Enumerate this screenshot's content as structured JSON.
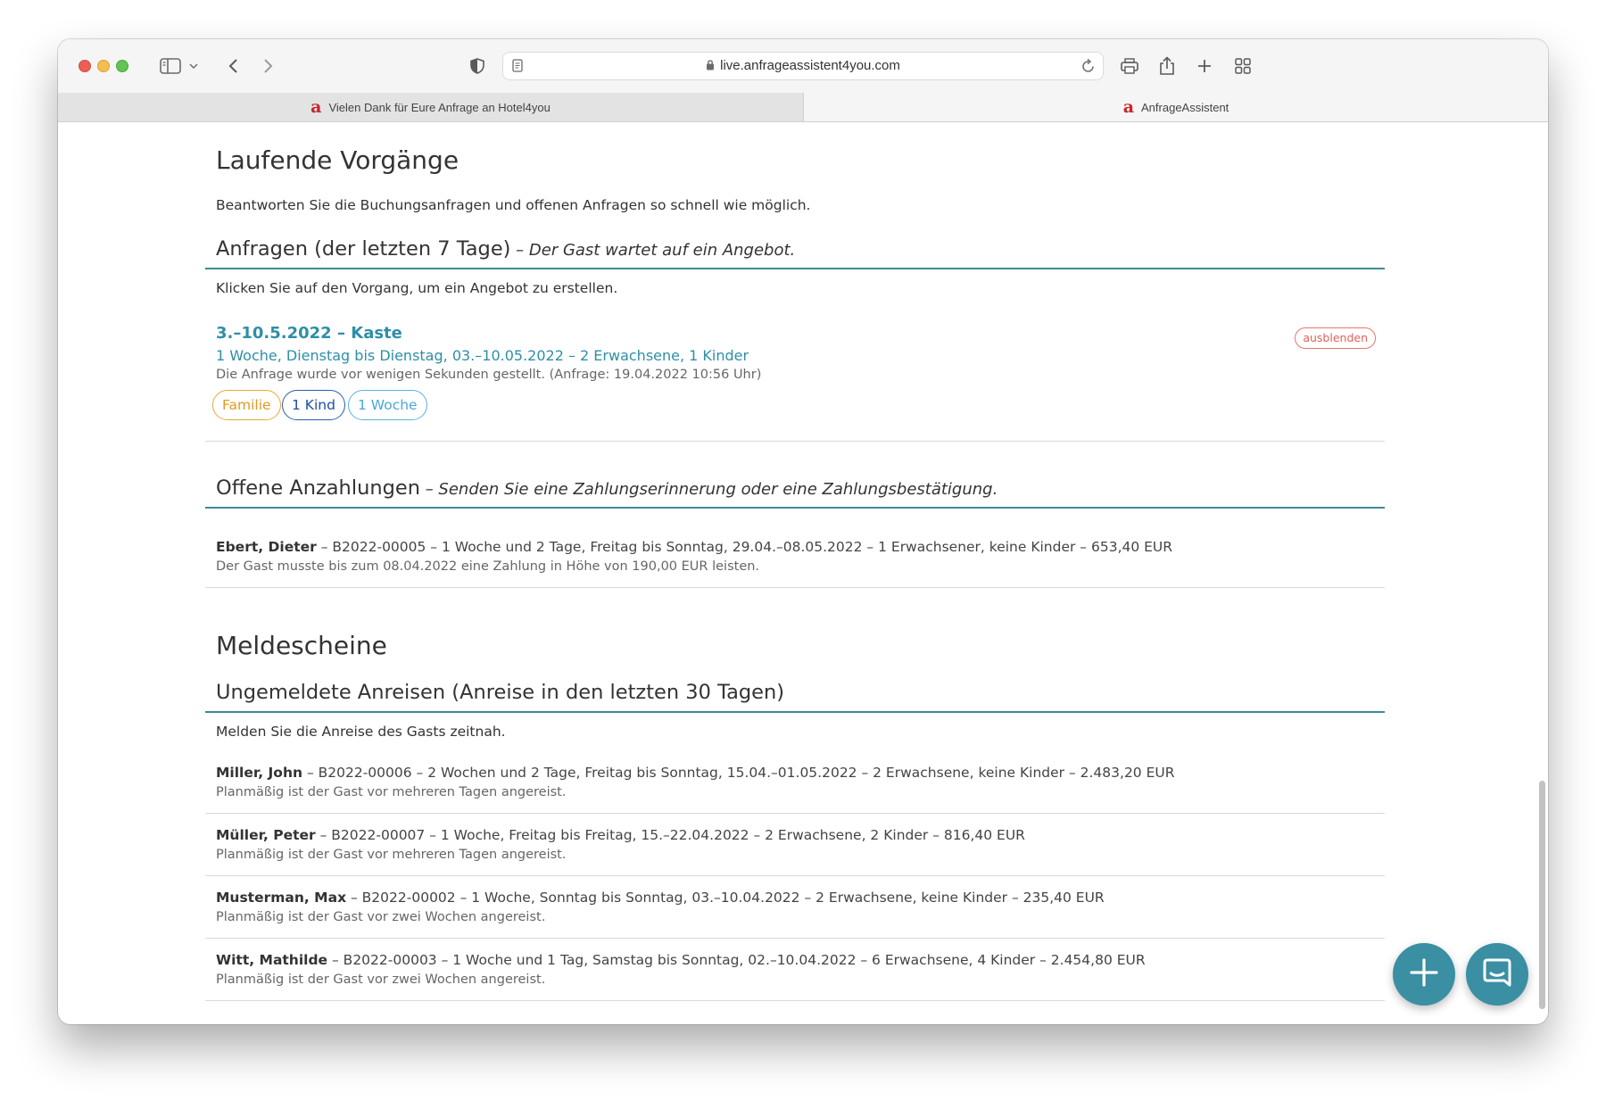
{
  "browser": {
    "url": "live.anfrageassistent4you.com",
    "tabs": [
      {
        "label": "Vielen Dank für Eure Anfrage an Hotel4you",
        "favicon": "a",
        "active": false
      },
      {
        "label": "AnfrageAssistent",
        "favicon": "a",
        "active": true
      }
    ]
  },
  "page": {
    "title": "Laufende Vorgänge",
    "intro": "Beantworten Sie die Buchungsanfragen und offenen Anfragen so schnell wie möglich."
  },
  "inquiries": {
    "heading": "Anfragen (der letzten 7 Tage)",
    "subheading": " – Der Gast wartet auf ein Angebot.",
    "hint": "Klicken Sie auf den Vorgang, um ein Angebot zu erstellen.",
    "items": [
      {
        "title": "3.–10.5.2022 – Kaste",
        "detail": "1 Woche, Dienstag bis Dienstag, 03.–10.05.2022 – 2 Erwachsene, 1 Kinder",
        "meta": "Die Anfrage wurde vor wenigen Sekunden gestellt. (Anfrage: 19.04.2022 10:56 Uhr)",
        "tags": [
          "Familie",
          "1 Kind",
          "1 Woche"
        ],
        "hide_label": "ausblenden"
      }
    ]
  },
  "deposits": {
    "heading": "Offene Anzahlungen",
    "subheading": " – Senden Sie eine Zahlungserinnerung oder eine Zahlungsbestätigung.",
    "items": [
      {
        "name": "Ebert, Dieter",
        "detail": " – B2022-00005 – 1 Woche und 2 Tage, Freitag bis Sonntag, 29.04.–08.05.2022 – 1 Erwachsener, keine Kinder – 653,40 EUR",
        "sub": "Der Gast musste bis zum 08.04.2022 eine Zahlung in Höhe von 190,00 EUR leisten."
      }
    ]
  },
  "registration": {
    "title": "Meldescheine",
    "heading": "Ungemeldete Anreisen (Anreise in den letzten 30 Tagen)",
    "hint": "Melden Sie die Anreise des Gasts zeitnah.",
    "items": [
      {
        "name": "Miller, John",
        "detail": " – B2022-00006 – 2 Wochen und 2 Tage, Freitag bis Sonntag, 15.04.–01.05.2022 – 2 Erwachsene, keine Kinder – 2.483,20 EUR",
        "sub": "Planmäßig ist der Gast vor mehreren Tagen angereist."
      },
      {
        "name": "Müller, Peter",
        "detail": " – B2022-00007 – 1 Woche, Freitag bis Freitag, 15.–22.04.2022 – 2 Erwachsene, 2 Kinder – 816,40 EUR",
        "sub": "Planmäßig ist der Gast vor mehreren Tagen angereist."
      },
      {
        "name": "Musterman, Max",
        "detail": " – B2022-00002 – 1 Woche, Sonntag bis Sonntag, 03.–10.04.2022 – 2 Erwachsene, keine Kinder – 235,40 EUR",
        "sub": "Planmäßig ist der Gast vor zwei Wochen angereist."
      },
      {
        "name": "Witt, Mathilde",
        "detail": " – B2022-00003 – 1 Woche und 1 Tag, Samstag bis Sonntag, 02.–10.04.2022 – 6 Erwachsene, 4 Kinder – 2.454,80 EUR",
        "sub": "Planmäßig ist der Gast vor zwei Wochen angereist."
      }
    ]
  },
  "colors": {
    "accent": "#3a8fa3",
    "link": "#2e8fa6",
    "tag_family": "#e49a1f",
    "tag_kind": "#1d4fa3",
    "tag_week": "#4aa7dc",
    "hide": "#e0605a"
  },
  "icons": {
    "fab_add": "plus-icon",
    "fab_chat": "chat-icon"
  }
}
